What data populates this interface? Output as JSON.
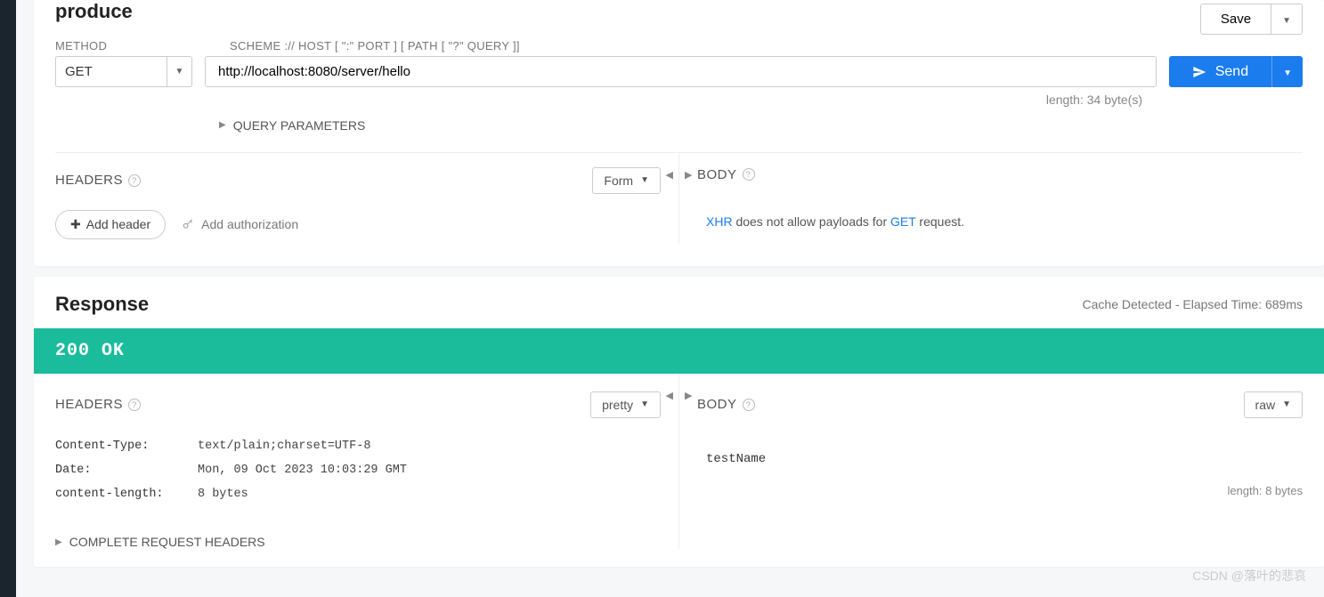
{
  "request": {
    "title": "produce",
    "save_label": "Save",
    "method_label": "METHOD",
    "url_label": "SCHEME :// HOST [ \":\" PORT ] [ PATH [ \"?\" QUERY ]]",
    "method_value": "GET",
    "url_value": "http://localhost:8080/server/hello",
    "send_label": "Send",
    "length_text": "length: 34 byte(s)",
    "query_params_label": "QUERY PARAMETERS",
    "headers_label": "HEADERS",
    "form_mode": "Form",
    "add_header_label": "Add header",
    "add_auth_label": "Add authorization",
    "body_label": "BODY",
    "body_msg_prefix": "XHR",
    "body_msg_mid": " does not allow payloads for ",
    "body_msg_method": "GET",
    "body_msg_suffix": " request."
  },
  "response": {
    "title": "Response",
    "meta": "Cache Detected - Elapsed Time: 689ms",
    "status": "200 OK",
    "headers_label": "HEADERS",
    "pretty_mode": "pretty",
    "body_label": "BODY",
    "raw_mode": "raw",
    "headers": [
      {
        "key": "Content-Type:",
        "val": "text/plain;charset=UTF-8"
      },
      {
        "key": "Date:",
        "val": "Mon, 09 Oct 2023 10:03:29 GMT"
      },
      {
        "key": "content-length:",
        "val": "8 bytes"
      }
    ],
    "complete_headers_label": "COMPLETE REQUEST HEADERS",
    "body_content": "testName",
    "body_length": "length: 8 bytes"
  },
  "watermark": "CSDN @落叶的悲哀"
}
